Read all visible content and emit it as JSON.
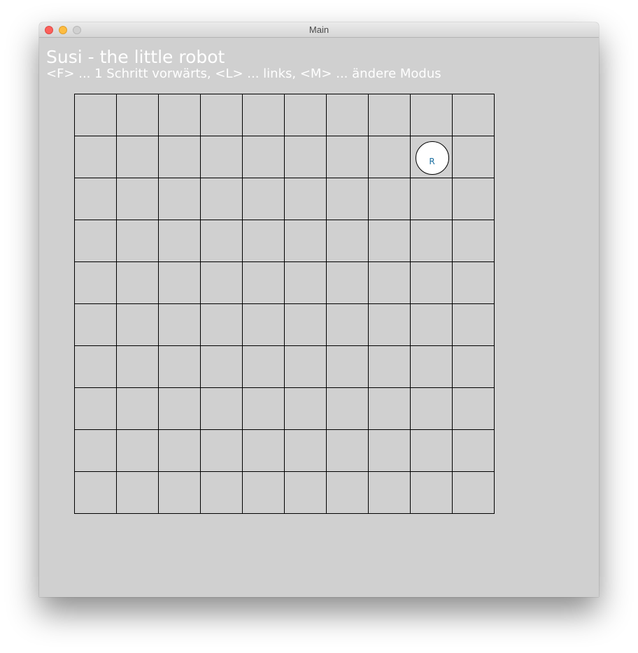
{
  "window": {
    "title": "Main"
  },
  "app": {
    "heading": "Susi - the little robot",
    "instructions": "<F> ... 1 Schritt vorwärts, <L> ... links, <M> ... ändere Modus"
  },
  "grid": {
    "rows": 10,
    "columns": 10
  },
  "robot": {
    "label": "R",
    "row": 1,
    "column": 8
  }
}
